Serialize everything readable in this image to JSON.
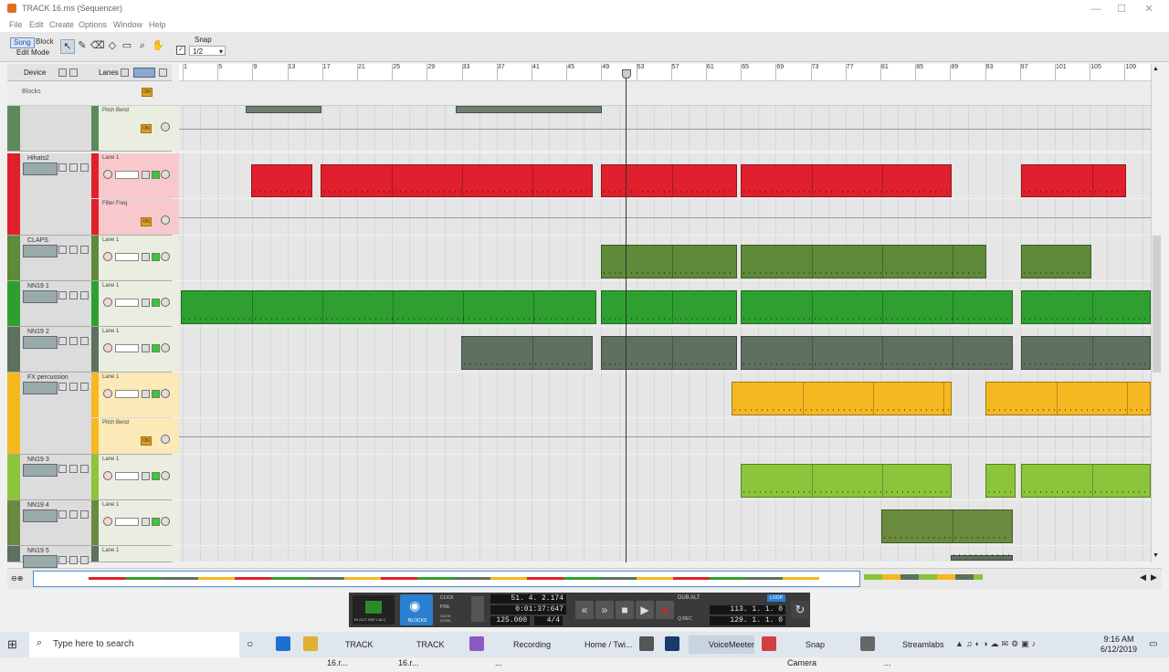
{
  "window": {
    "title": "TRACK 16.rns (Sequencer)"
  },
  "menu": [
    "File",
    "Edit",
    "Create",
    "Options",
    "Window",
    "Help"
  ],
  "toolbar": {
    "song": "Song",
    "block": "Block",
    "edit_mode": "Edit Mode",
    "snap_label": "Snap",
    "snap_value": "1/2"
  },
  "headers": {
    "device": "Device",
    "lanes": "Lanes",
    "blocks": "Blocks",
    "on": "ON"
  },
  "ruler": [
    "1",
    "5",
    "9",
    "13",
    "17",
    "21",
    "25",
    "29",
    "33",
    "37",
    "41",
    "45",
    "49",
    "53",
    "57",
    "61",
    "65",
    "69",
    "73",
    "77",
    "81",
    "85",
    "89",
    "93",
    "97",
    "101",
    "105",
    "109"
  ],
  "tracks": [
    {
      "name": "",
      "color": "#5c8a5c",
      "lanes": [
        {
          "label": "Pitch Bend",
          "auto": true
        }
      ]
    },
    {
      "name": "Hihats2",
      "color": "#e0202c",
      "lanes": [
        {
          "label": "Lane 1"
        },
        {
          "label": "Filter Freq",
          "auto": true
        }
      ]
    },
    {
      "name": "CLAPS",
      "color": "#5e8a3a",
      "lanes": [
        {
          "label": "Lane 1"
        }
      ]
    },
    {
      "name": "NN19 1",
      "color": "#2fa030",
      "lanes": [
        {
          "label": "Lane 1"
        }
      ]
    },
    {
      "name": "NN19 2",
      "color": "#5e7060",
      "lanes": [
        {
          "label": "Lane 1"
        }
      ]
    },
    {
      "name": "FX percussion",
      "color": "#f5b820",
      "lanes": [
        {
          "label": "Lane 1"
        },
        {
          "label": "Pitch Bend",
          "auto": true
        }
      ]
    },
    {
      "name": "NN19 3",
      "color": "#8cc43a",
      "lanes": [
        {
          "label": "Lane 1"
        }
      ]
    },
    {
      "name": "NN19 4",
      "color": "#6a8a40",
      "lanes": [
        {
          "label": "Lane 1"
        }
      ]
    },
    {
      "name": "NN19 5",
      "color": "#5e7060",
      "lanes": [
        {
          "label": "Lane 1"
        }
      ]
    }
  ],
  "transport": {
    "position_bars": "51. 4. 2.174",
    "position_time": "0:01:37:647",
    "tempo": "125.000",
    "signature": "4/4",
    "loop_label": "LOOP",
    "left_locator": "113. 1. 1.   0",
    "right_locator": "129. 1. 1.   0",
    "blocks_label": "BLOCKS",
    "click": "CLICK",
    "pre": "PRE",
    "click_level": "CLICK LEVEL",
    "in_out": "IN OUT DSP CALC",
    "dub": "DUB",
    "alt": "ALT",
    "q_rec": "Q REC"
  },
  "taskbar": {
    "search_placeholder": "Type here to search",
    "items": [
      "TRACK 16.r...",
      "TRACK 16.r...",
      "Recording ...",
      "Home / Twi...",
      "VoiceMeeter",
      "Snap Camera",
      "Streamlabs ..."
    ],
    "time": "9:16 AM",
    "date": "6/12/2019"
  }
}
